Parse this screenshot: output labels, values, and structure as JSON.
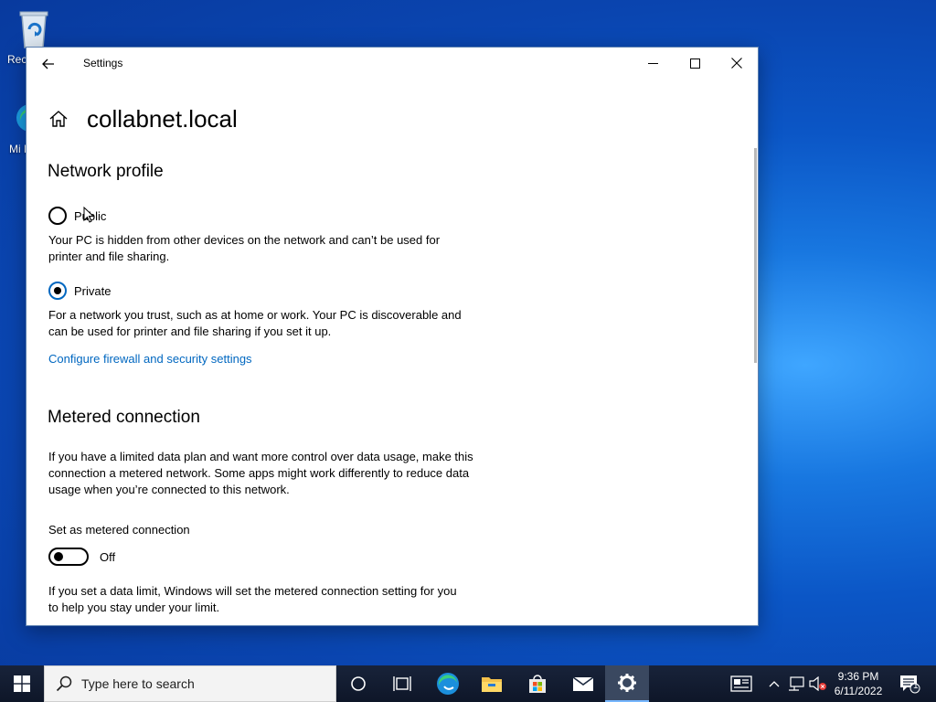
{
  "desktop": {
    "recycle_label": "Rec",
    "edge_label": "Mi E"
  },
  "window": {
    "title": "Settings",
    "page_title": "collabnet.local"
  },
  "network_profile": {
    "heading": "Network profile",
    "public_label": "Public",
    "public_desc": "Your PC is hidden from other devices on the network and can’t be used for printer and file sharing.",
    "private_label": "Private",
    "private_desc": "For a network you trust, such as at home or work. Your PC is discoverable and can be used for printer and file sharing if you set it up.",
    "selected": "Private",
    "firewall_link": "Configure firewall and security settings"
  },
  "metered": {
    "heading": "Metered connection",
    "desc": "If you have a limited data plan and want more control over data usage, make this connection a metered network. Some apps might work differently to reduce data usage when you’re connected to this network.",
    "toggle_label": "Set as metered connection",
    "toggle_state": "Off",
    "limit_desc": "If you set a data limit, Windows will set the metered connection setting for you to help you stay under your limit."
  },
  "taskbar": {
    "search_placeholder": "Type here to search",
    "time": "9:36 PM",
    "date": "6/11/2022",
    "notification_count": "1",
    "active_app": "settings"
  },
  "colors": {
    "accent": "#0067c0",
    "taskbar": "#101828"
  }
}
